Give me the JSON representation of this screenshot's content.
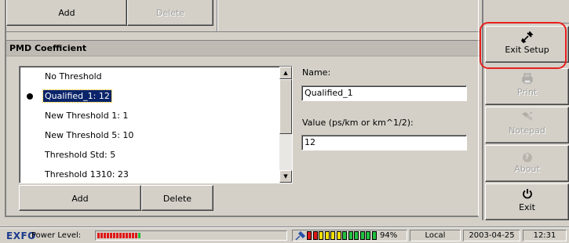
{
  "top_group": {
    "add_label": "Add",
    "delete_label": "Delete"
  },
  "pmd": {
    "title": "PMD Coefficient",
    "thresholds": [
      {
        "label": "No Threshold",
        "selected": false
      },
      {
        "label": "Qualified_1: 12",
        "selected": true
      },
      {
        "label": "New Threshold 1: 1",
        "selected": false
      },
      {
        "label": "New Threshold 5: 10",
        "selected": false
      },
      {
        "label": "Threshold Std: 5",
        "selected": false
      },
      {
        "label": "Threshold 1310: 23",
        "selected": false
      }
    ],
    "name_label": "Name:",
    "name_value": "Qualified_1",
    "value_label": "Value (ps/km or km^1/2):",
    "value_value": "12",
    "add_label": "Add",
    "delete_label": "Delete"
  },
  "side_menu": {
    "exit_setup_label": "Exit Setup",
    "print_label": "Print",
    "notepad_label": "Notepad",
    "about_label": "About",
    "exit_label": "Exit",
    "icons": {
      "exit_setup": "tools-icon",
      "print": "printer-icon",
      "notepad": "notepad-icon",
      "about": "about-icon",
      "exit": "power-icon"
    }
  },
  "status_bar": {
    "logo": "EXFO",
    "power_label": "Power Level:",
    "power_level": 0.6,
    "battery_percent": "94%",
    "mode": "Local",
    "date": "2003-04-25",
    "time": "12:31"
  },
  "colors": {
    "window_bg": "#d4d0c8",
    "selection_bg": "#0a246a",
    "highlight_ring": "#e8201f",
    "logo": "#1c3b8c"
  }
}
